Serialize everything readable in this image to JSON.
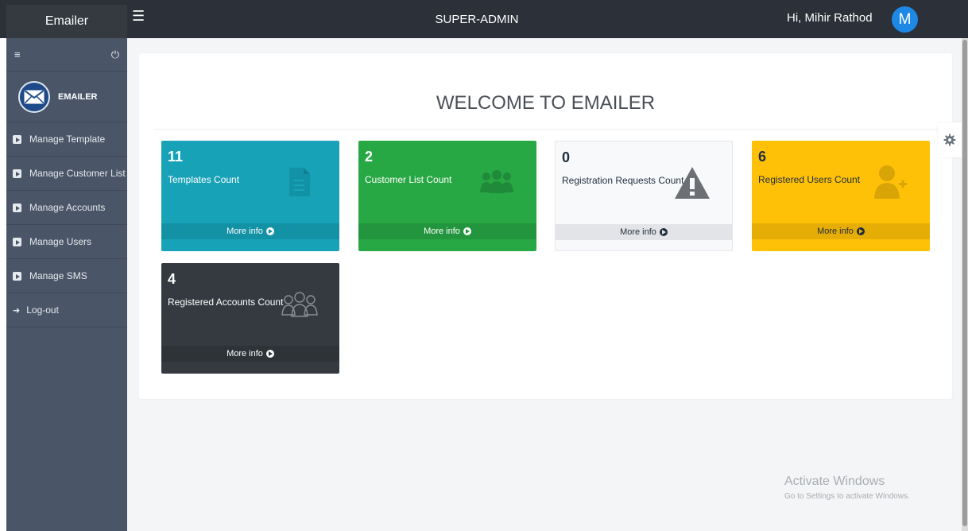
{
  "topbar": {
    "brand": "Emailer",
    "title": "SUPER-ADMIN",
    "greeting": "Hi, Mihir Rathod",
    "avatar_letter": "M"
  },
  "sidebar": {
    "logo_label": "EMAILER",
    "items": [
      {
        "label": "Manage Template",
        "icon": "play-square-icon"
      },
      {
        "label": "Manage Customer List",
        "icon": "play-square-icon"
      },
      {
        "label": "Manage Accounts",
        "icon": "play-square-icon"
      },
      {
        "label": "Manage Users",
        "icon": "play-square-icon"
      },
      {
        "label": "Manage SMS",
        "icon": "play-square-icon"
      },
      {
        "label": "Log-out",
        "icon": "sign-out-icon"
      }
    ]
  },
  "main": {
    "welcome": "WELCOME TO EMAILER",
    "cards": [
      {
        "count": "11",
        "label": "Templates Count",
        "more": "More info",
        "color": "#17a2b8",
        "icon": "document-icon"
      },
      {
        "count": "2",
        "label": "Customer List Count",
        "more": "More info",
        "color": "#28a745",
        "icon": "users-icon"
      },
      {
        "count": "0",
        "label": "Registration Requests Count",
        "more": "More info",
        "color": "#f8f9fa",
        "icon": "warning-icon"
      },
      {
        "count": "6",
        "label": "Registered Users Count",
        "more": "More info",
        "color": "#ffc107",
        "icon": "user-plus-icon"
      },
      {
        "count": "4",
        "label": "Registered Accounts Count",
        "more": "More info",
        "color": "#343a40",
        "icon": "users-outline-icon"
      }
    ]
  },
  "watermark": {
    "line1": "Activate Windows",
    "line2": "Go to Settings to activate Windows."
  }
}
